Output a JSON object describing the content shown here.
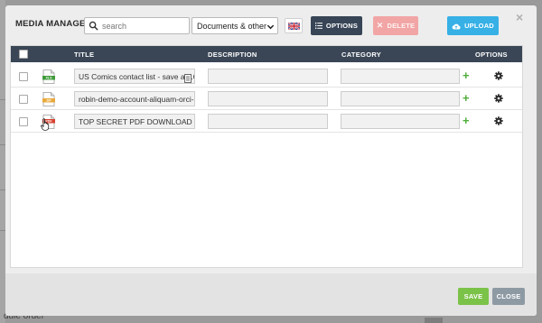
{
  "background": {
    "bottom_left_text": "dule order"
  },
  "modal": {
    "title": "MEDIA MANAGER",
    "search": {
      "placeholder": "search",
      "value": ""
    },
    "filter": {
      "selected": "Documents & other"
    },
    "language_flag": "uk-flag-icon",
    "buttons": {
      "options": "OPTIONS",
      "delete": "DELETE",
      "upload": "UPLOAD",
      "save": "SAVE",
      "close": "CLOSE"
    },
    "table": {
      "columns": [
        "TITLE",
        "DESCRIPTION",
        "CATEGORY",
        "OPTIONS"
      ],
      "rows": [
        {
          "file_type": "XLS",
          "title": "US Comics contact list - save as .CSV",
          "description": "",
          "category": ""
        },
        {
          "file_type": "ZIP",
          "title": "robin-demo-account-aliquam-orci-nulla",
          "description": "",
          "category": ""
        },
        {
          "file_type": "PDF",
          "title": "TOP SECRET PDF DOWNLOAD",
          "description": "",
          "category": ""
        }
      ]
    }
  },
  "colors": {
    "header_dark": "#3a4656",
    "options_button": "#374556",
    "delete_button": "#f2a5a5",
    "upload_button": "#37b0e6",
    "save_button": "#7bc249",
    "close_button": "#8e9aa3",
    "add_green": "#4fae3a"
  }
}
